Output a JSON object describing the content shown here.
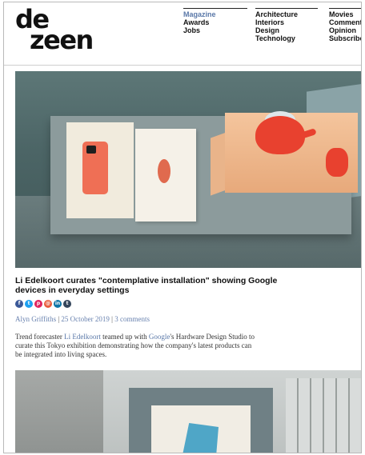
{
  "header": {
    "logo_line1": "de",
    "logo_line2": "zeen",
    "nav_col1": [
      "Magazine",
      "Awards",
      "Jobs"
    ],
    "nav_col2": [
      "Architecture",
      "Interiors",
      "Design",
      "Technology"
    ],
    "nav_col3": [
      "Movies",
      "Comments",
      "Opinion",
      "Subscribe"
    ]
  },
  "article": {
    "title": "Li Edelkoort curates \"contemplative installation\" showing Google devices in everyday settings",
    "share_icons": [
      "facebook-icon",
      "twitter-icon",
      "pinterest-icon",
      "email-icon",
      "linkedin-icon",
      "tumblr-icon"
    ],
    "share_glyphs": [
      "f",
      "t",
      "p",
      "@",
      "in",
      "t"
    ],
    "share_colors": [
      "#3b5998",
      "#1da1f2",
      "#e0245e",
      "#e85d3d",
      "#0e76a8",
      "#35465c"
    ],
    "author": "Alyn Griffiths",
    "date": "25 October 2019",
    "comments": "3 comments",
    "body_part1": "Trend forecaster ",
    "body_link1": "Li Edelkoort",
    "body_part2": " teamed up with ",
    "body_link2": "Google",
    "body_part3": "'s Hardware Design Studio to curate this Tokyo exhibition demonstrating how the company's latest products can be integrated into living spaces."
  },
  "colors": {
    "accent_link": "#5a78a8",
    "active_nav": "#5a78a8"
  }
}
